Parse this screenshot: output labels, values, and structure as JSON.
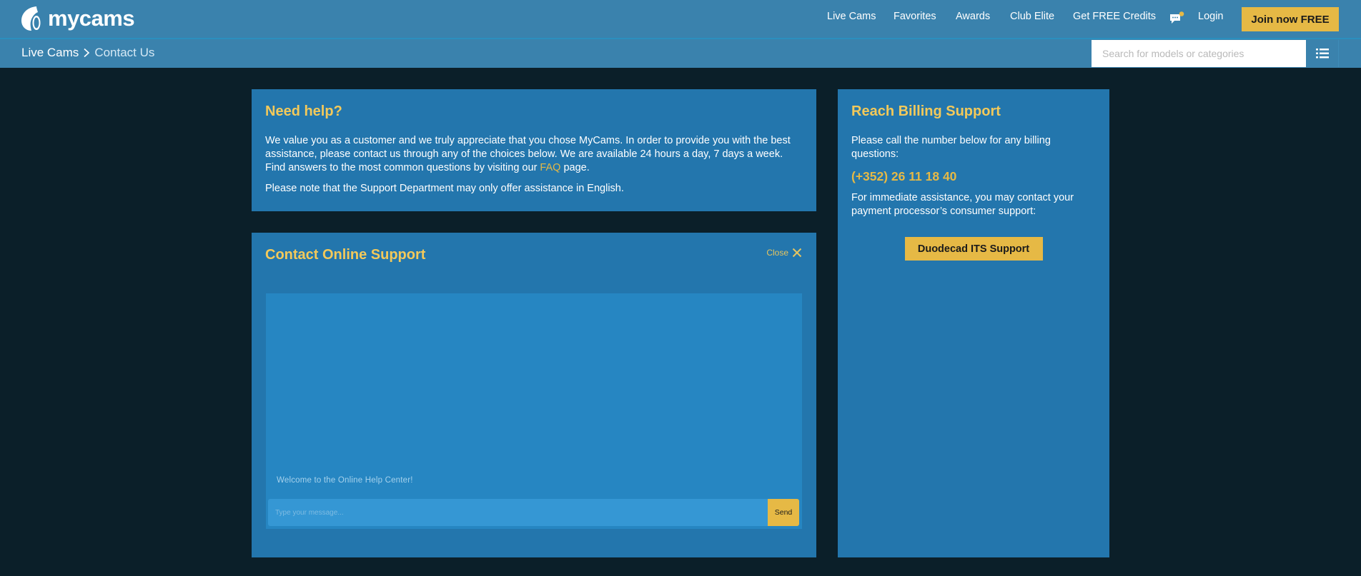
{
  "header": {
    "logo_text": "mycams",
    "nav": [
      {
        "label": "Live Cams"
      },
      {
        "label": "Favorites"
      },
      {
        "label": "Awards"
      },
      {
        "label": "Club Elite"
      },
      {
        "label": "Get FREE Credits"
      }
    ],
    "login_label": "Login",
    "join_label": "Join now FREE",
    "chat_icon": "chat-notification-icon"
  },
  "breadcrumb": {
    "items": [
      {
        "label": "Live Cams"
      },
      {
        "label": "Contact Us"
      }
    ]
  },
  "search": {
    "placeholder": "Search for models or categories",
    "value": ""
  },
  "help": {
    "title": "Need help?",
    "paragraph1_before_link": "We value you as a customer and we truly appreciate that you chose MyCams. In order to provide you with the best assistance, please contact us through any of the choices below. We are available 24 hours a day, 7 days a week. Find answers to the most common questions by visiting our ",
    "faq_link": "FAQ",
    "paragraph1_after_link": " page.",
    "paragraph2": "Please note that the Support Department may only offer assistance in English."
  },
  "contact": {
    "title": "Contact Online Support",
    "close_label": "Close",
    "welcome_message": "Welcome to the Online Help Center!",
    "input_placeholder": "Type your message...",
    "input_value": "",
    "send_label": "Send"
  },
  "billing": {
    "title": "Reach Billing Support",
    "intro": "Please call the number below for any billing questions:",
    "phone": "(+352) 26 11 18 40",
    "processor_text": "For immediate assistance, you may contact your payment processor’s consumer support:",
    "button_label": "Duodecad ITS Support"
  },
  "colors": {
    "header_bg": "#3a82ad",
    "page_bg": "#0b1f29",
    "panel_bg": "#2376ad",
    "accent_yellow": "#e6b945",
    "title_yellow": "#f3c95a"
  }
}
